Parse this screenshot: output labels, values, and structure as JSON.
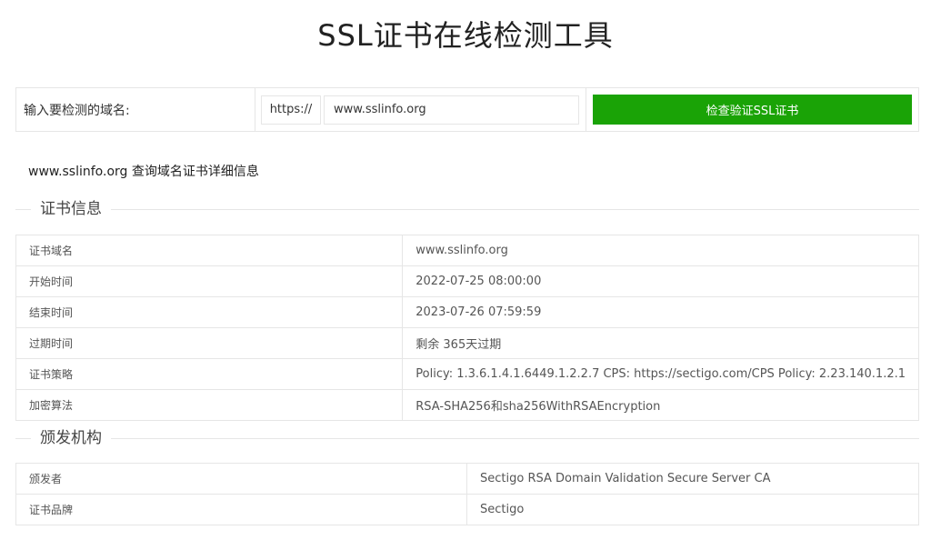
{
  "header": {
    "title": "SSL证书在线检测工具"
  },
  "query": {
    "label": "输入要检测的域名:",
    "protocol": "https://",
    "domain_value": "www.sslinfo.org",
    "submit_label": "检查验证SSL证书"
  },
  "result": {
    "heading": "www.sslinfo.org 查询域名证书详细信息"
  },
  "cert_section": {
    "title": "证书信息",
    "rows": [
      {
        "key": "证书域名",
        "value": "www.sslinfo.org"
      },
      {
        "key": "开始时间",
        "value": "2022-07-25 08:00:00"
      },
      {
        "key": "结束时间",
        "value": "2023-07-26 07:59:59"
      },
      {
        "key": "过期时间",
        "value": "剩余 365天过期"
      },
      {
        "key": "证书策略",
        "value": "Policy: 1.3.6.1.4.1.6449.1.2.2.7 CPS: https://sectigo.com/CPS Policy: 2.23.140.1.2.1"
      },
      {
        "key": "加密算法",
        "value": "RSA-SHA256和sha256WithRSAEncryption"
      }
    ]
  },
  "issuer_section": {
    "title": "颁发机构",
    "rows": [
      {
        "key": "颁发者",
        "value": "Sectigo RSA Domain Validation Secure Server CA"
      },
      {
        "key": "证书品牌",
        "value": "Sectigo"
      }
    ]
  },
  "colors": {
    "accent": "#1aa306",
    "border": "#e6e6e6"
  }
}
